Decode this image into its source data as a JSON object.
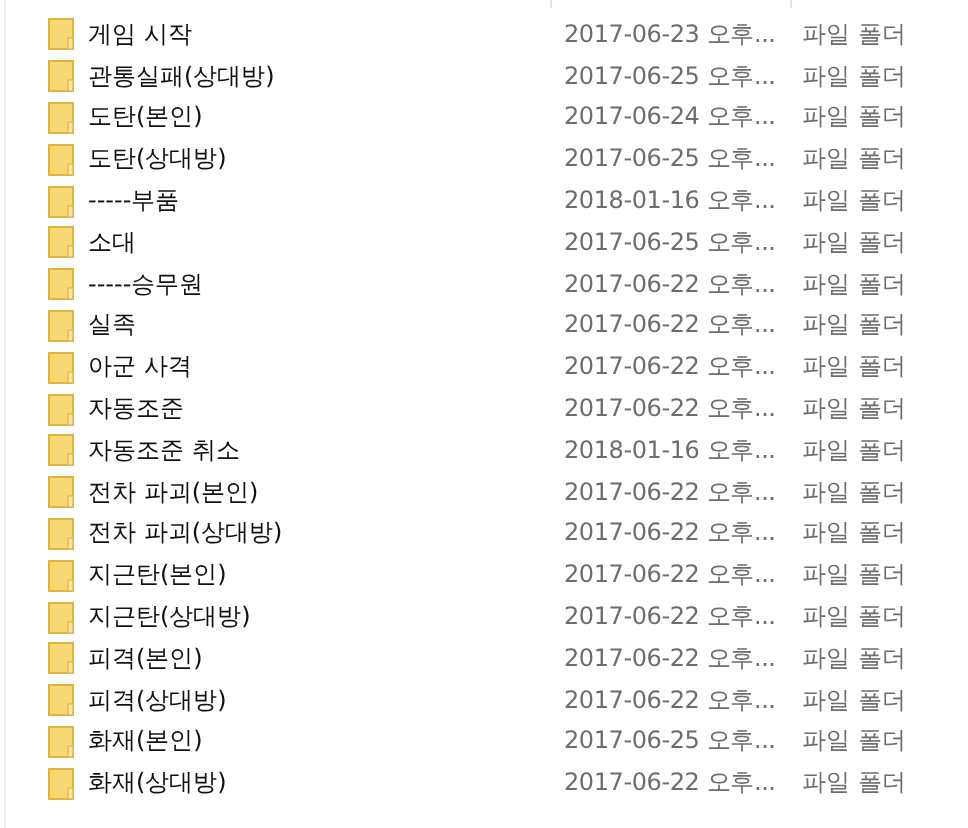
{
  "rows": [
    {
      "name": "게임 시작",
      "date": "2017-06-23 오후...",
      "type": "파일 폴더"
    },
    {
      "name": "관통실패(상대방)",
      "date": "2017-06-25 오후...",
      "type": "파일 폴더"
    },
    {
      "name": "도탄(본인)",
      "date": "2017-06-24 오후...",
      "type": "파일 폴더"
    },
    {
      "name": "도탄(상대방)",
      "date": "2017-06-25 오후...",
      "type": "파일 폴더"
    },
    {
      "name": "-----부품",
      "date": "2018-01-16 오후...",
      "type": "파일 폴더"
    },
    {
      "name": "소대",
      "date": "2017-06-25 오후...",
      "type": "파일 폴더"
    },
    {
      "name": "-----승무원",
      "date": "2017-06-22 오후...",
      "type": "파일 폴더"
    },
    {
      "name": "실족",
      "date": "2017-06-22 오후...",
      "type": "파일 폴더"
    },
    {
      "name": "아군 사격",
      "date": "2017-06-22 오후...",
      "type": "파일 폴더"
    },
    {
      "name": "자동조준",
      "date": "2017-06-22 오후...",
      "type": "파일 폴더"
    },
    {
      "name": "자동조준 취소",
      "date": "2018-01-16 오후...",
      "type": "파일 폴더"
    },
    {
      "name": "전차 파괴(본인)",
      "date": "2017-06-22 오후...",
      "type": "파일 폴더"
    },
    {
      "name": "전차 파괴(상대방)",
      "date": "2017-06-22 오후...",
      "type": "파일 폴더"
    },
    {
      "name": "지근탄(본인)",
      "date": "2017-06-22 오후...",
      "type": "파일 폴더"
    },
    {
      "name": "지근탄(상대방)",
      "date": "2017-06-22 오후...",
      "type": "파일 폴더"
    },
    {
      "name": "피격(본인)",
      "date": "2017-06-22 오후...",
      "type": "파일 폴더"
    },
    {
      "name": "피격(상대방)",
      "date": "2017-06-22 오후...",
      "type": "파일 폴더"
    },
    {
      "name": "화재(본인)",
      "date": "2017-06-25 오후...",
      "type": "파일 폴더"
    },
    {
      "name": "화재(상대방)",
      "date": "2017-06-22 오후...",
      "type": "파일 폴더"
    }
  ]
}
